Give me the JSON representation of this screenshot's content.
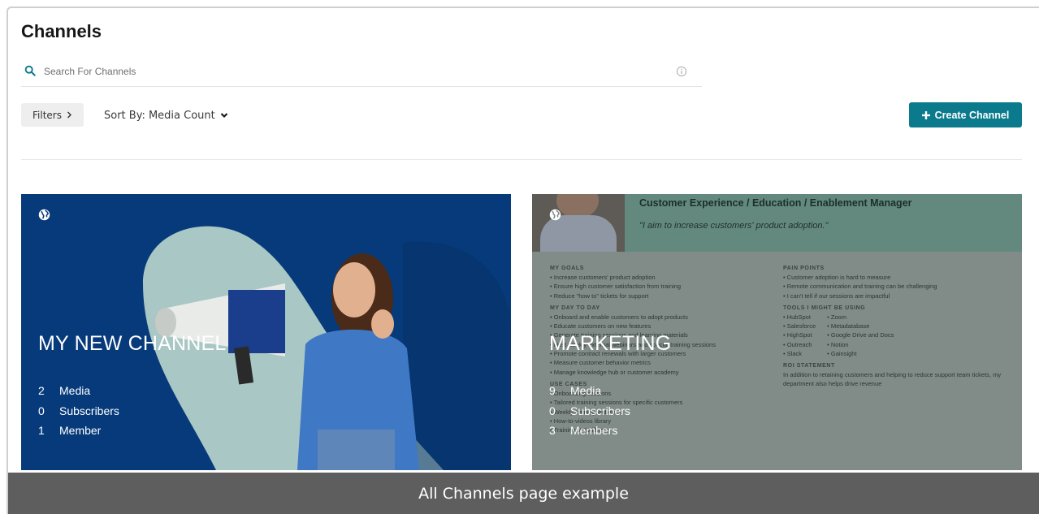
{
  "page": {
    "title": "Channels"
  },
  "search": {
    "placeholder": "Search For Channels"
  },
  "toolbar": {
    "filters_label": "Filters",
    "sort_label": "Sort By: Media Count",
    "create_label": "Create Channel"
  },
  "colors": {
    "accent": "#0b7a8c",
    "card_blue": "#063a7a",
    "caption_bg": "#5e5e5e"
  },
  "icons": {
    "search": "search-icon",
    "info": "info-icon",
    "chevron": "chevron-right-icon",
    "sort": "chevron-down-icon",
    "plus": "plus-icon",
    "globe": "globe-icon"
  },
  "channels": [
    {
      "title": "MY NEW CHANNEL",
      "stats": [
        {
          "count": "2",
          "label": "Media"
        },
        {
          "count": "0",
          "label": "Subscribers"
        },
        {
          "count": "1",
          "label": "Member"
        }
      ]
    },
    {
      "title": "MARKETING",
      "stats": [
        {
          "count": "9",
          "label": "Media"
        },
        {
          "count": "0",
          "label": "Subscribers"
        },
        {
          "count": "3",
          "label": "Members"
        }
      ],
      "thumbnail": {
        "role": "Customer Experience / Education / Enablement Manager",
        "quote": "\"I aim to increase customers' product adoption.\"",
        "goals_heading": "MY GOALS",
        "goals": [
          "• Increase customers' product adoption",
          "• Ensure high customer satisfaction from training",
          "• Reduce \"how to\" tickets for support"
        ],
        "day_heading": "MY DAY TO DAY",
        "day": [
          "• Onboard and enable customers to adopt products",
          "• Educate customers on new features",
          "• Generate training sessions and learning materials",
          "• Host weekly external webinars and special training sessions",
          "• Promote contract renewals with larger customers",
          "• Measure customer behavior metrics",
          "• Manage knowledge hub or customer academy"
        ],
        "use_heading": "USE CASES",
        "use": [
          "• Onboarding sessions",
          "• Tailored training sessions for specific customers",
          "• Weekly training webinars",
          "• How-to-videos library",
          "• Training VOD library"
        ],
        "pain_heading": "PAIN POINTS",
        "pain": [
          "• Customer adoption is hard to measure",
          "• Remote communication and training can be challenging",
          "• I can't tell if our sessions are impactful"
        ],
        "tools_heading": "TOOLS I MIGHT BE USING",
        "tools_left": [
          "• HubSpot",
          "• Salesforce",
          "• HighSpot",
          "• Outreach",
          "• Slack"
        ],
        "tools_right": [
          "• Zoom",
          "• Metadatabase",
          "• Google Drive and Docs",
          "• Notion",
          "• Gainsight"
        ],
        "roi_heading": "ROI STATEMENT",
        "roi": "In addition to retaining customers and helping to reduce support team tickets, my department also helps drive revenue"
      }
    }
  ],
  "caption": "All Channels page example"
}
